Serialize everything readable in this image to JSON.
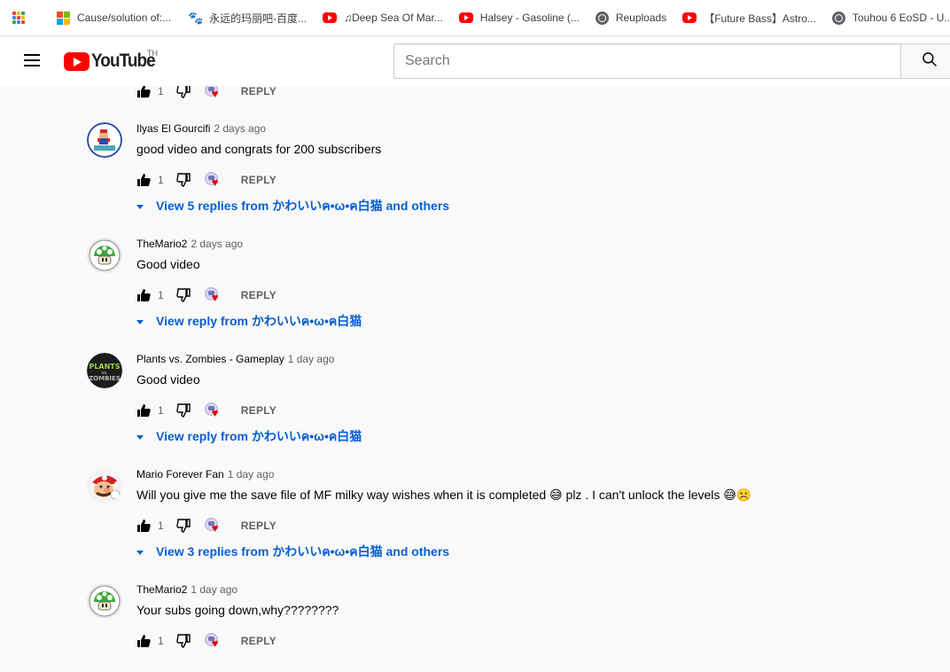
{
  "bookmarks": [
    {
      "label": "Cause/solution of:...",
      "icon": "microsoft-icon"
    },
    {
      "label": "永远的玛丽吧-百度...",
      "icon": "baidu-paw-icon"
    },
    {
      "label": "♫Deep Sea Of Mar...",
      "icon": "youtube-icon"
    },
    {
      "label": "Halsey - Gasoline (...",
      "icon": "youtube-icon"
    },
    {
      "label": "Reuploads",
      "icon": "globe-icon"
    },
    {
      "label": "【Future Bass】Astro...",
      "icon": "youtube-icon"
    },
    {
      "label": "Touhou 6 EoSD - U...",
      "icon": "globe-icon"
    }
  ],
  "masthead": {
    "logo_text": "YouTube",
    "country_code": "TH",
    "search_placeholder": "Search"
  },
  "comments": [
    {
      "author": "",
      "time": "",
      "text": "",
      "likes": "1",
      "reply_label": "REPLY",
      "replies_link": "",
      "avatar": "faded"
    },
    {
      "author": "Ilyas El Gourcifi",
      "time": "2 days ago",
      "text": "good video and congrats for 200 subscribers",
      "likes": "1",
      "reply_label": "REPLY",
      "replies_link": "View 5 replies from かわいいค•ω•ค白猫 and others",
      "avatar": "mario-sprite"
    },
    {
      "author": "TheMario2",
      "time": "2 days ago",
      "text": "Good video",
      "likes": "1",
      "reply_label": "REPLY",
      "replies_link": "View reply from かわいいค•ω•ค白猫",
      "avatar": "green-mushroom"
    },
    {
      "author": "Plants vs. Zombies - Gameplay",
      "time": "1 day ago",
      "text": "Good video",
      "likes": "1",
      "reply_label": "REPLY",
      "replies_link": "View reply from かわいいค•ω•ค白猫",
      "avatar": "pvz-logo"
    },
    {
      "author": "Mario Forever Fan",
      "time": "1 day ago",
      "text": "Will you give me the save file of MF milky way wishes when it is completed 😅 plz . I can't unlock the levels 😅☹️",
      "likes": "1",
      "reply_label": "REPLY",
      "replies_link": "View 3 replies from かわいいค•ω•ค白猫 and others",
      "avatar": "mario-face"
    },
    {
      "author": "TheMario2",
      "time": "1 day ago",
      "text": "Your subs going down,why????????",
      "likes": "1",
      "reply_label": "REPLY",
      "replies_link": "",
      "avatar": "green-mushroom"
    }
  ],
  "colors": {
    "link_blue": "#065fd4",
    "youtube_red": "#ff0000",
    "heart_red": "#e00000"
  }
}
